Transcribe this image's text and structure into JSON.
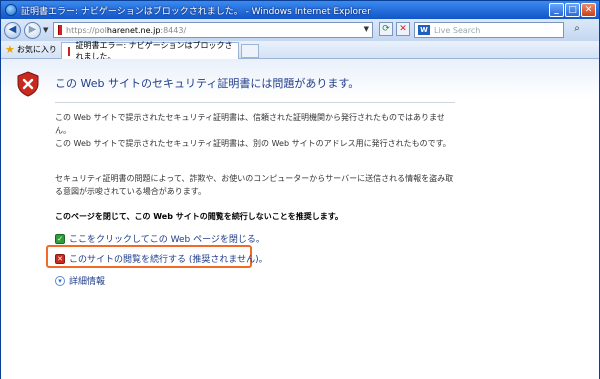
{
  "window": {
    "title": "証明書エラー: ナビゲーションはブロックされました。 - Windows Internet Explorer",
    "buttons": {
      "minimize": "_",
      "maximize": "□",
      "close": "✕"
    }
  },
  "address_bar": {
    "url_prefix": "https://pol",
    "url_host": "harenet.ne.jp",
    "url_suffix": ":8443/",
    "search_placeholder": "Live Search"
  },
  "favorites": {
    "label": "お気に入り"
  },
  "tab": {
    "label": "証明書エラー: ナビゲーションはブロックされました。"
  },
  "page": {
    "heading": "この Web サイトのセキュリティ証明書には問題があります。",
    "paragraph1": "この Web サイトで提示されたセキュリティ証明書は、信頼された証明機関から発行されたものではありません。",
    "paragraph2": "この Web サイトで提示されたセキュリティ証明書は、別の Web サイトのアドレス用に発行されたものです。",
    "paragraph3": "セキュリティ証明書の問題によって、詐欺や、お使いのコンピューターからサーバーに送信される情報を盗み取る意図が示唆されている場合があります。",
    "recommendation": "このページを閉じて、この Web サイトの閲覧を続行しないことを推奨します。",
    "close_link": "ここをクリックしてこの Web ページを閉じる。",
    "continue_link": "このサイトの閲覧を続行する (推奨されません)。",
    "details_link": "詳細情報"
  },
  "icons": {
    "shield": "shield-error-icon",
    "close_link_icon": "green-shield-icon",
    "continue_link_icon": "red-shield-icon",
    "details_icon": "expand-circle-icon"
  },
  "colors": {
    "highlight_border": "#f26a2a",
    "link": "#1f3d8a"
  }
}
